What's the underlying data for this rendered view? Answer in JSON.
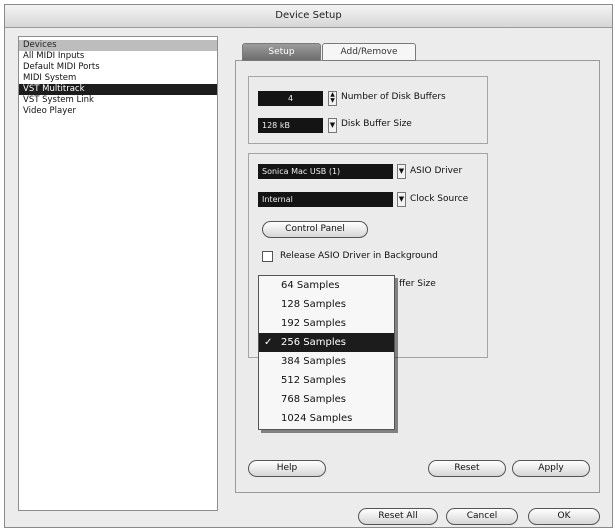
{
  "window": {
    "title": "Device Setup"
  },
  "devices": [
    {
      "label": "Devices"
    },
    {
      "label": "All MIDI Inputs"
    },
    {
      "label": "Default MIDI Ports"
    },
    {
      "label": "MIDI System"
    },
    {
      "label": "VST Multitrack"
    },
    {
      "label": "VST System Link"
    },
    {
      "label": "Video Player"
    }
  ],
  "tabs": [
    {
      "label": "Setup"
    },
    {
      "label": "Add/Remove"
    }
  ],
  "disk": {
    "buffers_value": "4",
    "buffers_label": "Number of Disk Buffers",
    "size_value": "128 kB",
    "size_label": "Disk Buffer Size"
  },
  "asio": {
    "driver_value": "Sonica Mac USB (1)",
    "driver_label": "ASIO Driver",
    "clock_value": "Internal",
    "clock_label": "Clock Source",
    "control_panel": "Control Panel",
    "release_label": "Release ASIO Driver in Background",
    "buffer_partial_label": "ffer Size"
  },
  "buffer_options": [
    {
      "label": "64 Samples",
      "checked": false
    },
    {
      "label": "128 Samples",
      "checked": false
    },
    {
      "label": "192 Samples",
      "checked": false
    },
    {
      "label": "256 Samples",
      "checked": true
    },
    {
      "label": "384 Samples",
      "checked": false
    },
    {
      "label": "512 Samples",
      "checked": false
    },
    {
      "label": "768 Samples",
      "checked": false
    },
    {
      "label": "1024 Samples",
      "checked": false
    }
  ],
  "check_glyph": "✓",
  "buttons": {
    "help": "Help",
    "reset": "Reset",
    "apply": "Apply",
    "reset_all": "Reset All",
    "cancel": "Cancel",
    "ok": "OK"
  }
}
